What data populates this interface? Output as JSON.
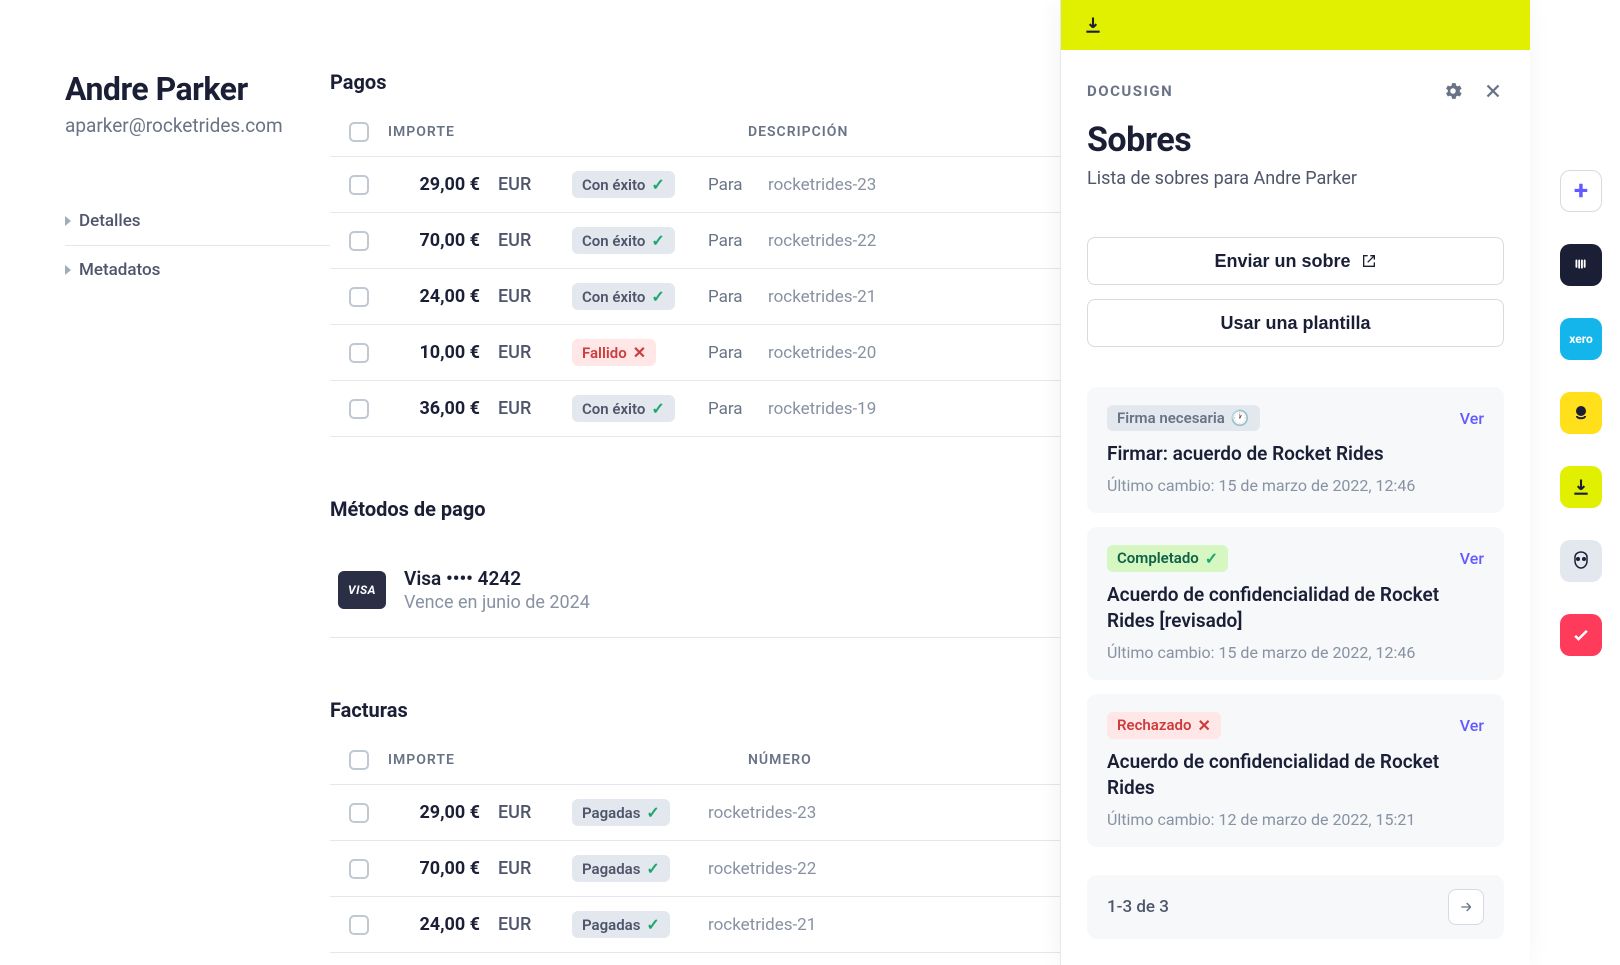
{
  "customer": {
    "name": "Andre Parker",
    "email": "aparker@rocketrides.com"
  },
  "nav": {
    "details": "Detalles",
    "metadata": "Metadatos"
  },
  "payments": {
    "title": "Pagos",
    "headers": {
      "amount": "IMPORTE",
      "description": "DESCRIPCIÓN"
    },
    "for_label": "Para",
    "status_success": "Con éxito",
    "status_failed": "Fallido",
    "rows": [
      {
        "amount": "29,00 €",
        "cur": "EUR",
        "status": "success",
        "ref": "rocketrides-23"
      },
      {
        "amount": "70,00 €",
        "cur": "EUR",
        "status": "success",
        "ref": "rocketrides-22"
      },
      {
        "amount": "24,00 €",
        "cur": "EUR",
        "status": "success",
        "ref": "rocketrides-21"
      },
      {
        "amount": "10,00 €",
        "cur": "EUR",
        "status": "failed",
        "ref": "rocketrides-20"
      },
      {
        "amount": "36,00 €",
        "cur": "EUR",
        "status": "success",
        "ref": "rocketrides-19"
      }
    ]
  },
  "payment_methods": {
    "title": "Métodos de pago",
    "card_brand": "VISA",
    "card_line1": "Visa •••• 4242",
    "card_line2": "Vence en junio de 2024"
  },
  "invoices": {
    "title": "Facturas",
    "headers": {
      "amount": "IMPORTE",
      "number": "NÚMERO"
    },
    "status_paid": "Pagadas",
    "rows": [
      {
        "amount": "29,00 €",
        "cur": "EUR",
        "ref": "rocketrides-23"
      },
      {
        "amount": "70,00 €",
        "cur": "EUR",
        "ref": "rocketrides-22"
      },
      {
        "amount": "24,00 €",
        "cur": "EUR",
        "ref": "rocketrides-21"
      }
    ]
  },
  "panel": {
    "app": "DOCUSIGN",
    "title": "Sobres",
    "subtitle": "Lista de sobres para Andre Parker",
    "send_btn": "Enviar un sobre",
    "template_btn": "Usar una plantilla",
    "view_link": "Ver",
    "status_sig_needed": "Firma necesaria",
    "status_completed": "Completado",
    "status_rejected": "Rechazado",
    "envelopes": [
      {
        "status": "sig",
        "title": "Firmar: acuerdo de Rocket Rides",
        "meta": "Último cambio: 15 de marzo de 2022, 12:46"
      },
      {
        "status": "done",
        "title": "Acuerdo de confidencialidad de Rocket Rides [revisado]",
        "meta": "Último cambio: 15 de marzo de 2022, 12:46"
      },
      {
        "status": "rej",
        "title": "Acuerdo de confidencialidad de Rocket Rides",
        "meta": "Último cambio: 12 de marzo de 2022, 15:21"
      }
    ],
    "pagination": "1-3 de 3"
  },
  "rail": {
    "xero": "xero"
  }
}
